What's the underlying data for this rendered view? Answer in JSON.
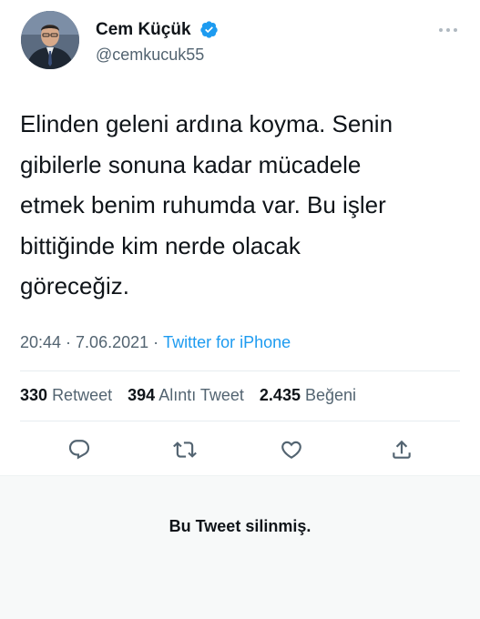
{
  "user": {
    "display_name": "Cem Küçük",
    "handle": "@cemkucuk55",
    "avatar_icon": "profile-photo",
    "verified": true
  },
  "tweet": {
    "text": "Elinden geleni ardına koyma. Senin\ngibilerle sonuna kadar mücadele\netmek benim ruhumda var. Bu işler\nbittiğinde kim nerde olacak\ngöreceğiz.",
    "time": "20:44",
    "date": "7.06.2021",
    "source": "Twitter for iPhone"
  },
  "stats": {
    "retweets": "330",
    "retweets_label": "Retweet",
    "quotes": "394",
    "quotes_label": "Alıntı Tweet",
    "likes": "2.435",
    "likes_label": "Beğeni"
  },
  "actions": {
    "reply_icon": "reply-icon",
    "retweet_icon": "retweet-icon",
    "like_icon": "heart-icon",
    "share_icon": "share-icon"
  },
  "notice": {
    "deleted_text": "Bu Tweet silinmiş."
  },
  "colors": {
    "accent": "#1d9bf0",
    "secondary_text": "#536471",
    "icon": "#536471"
  }
}
